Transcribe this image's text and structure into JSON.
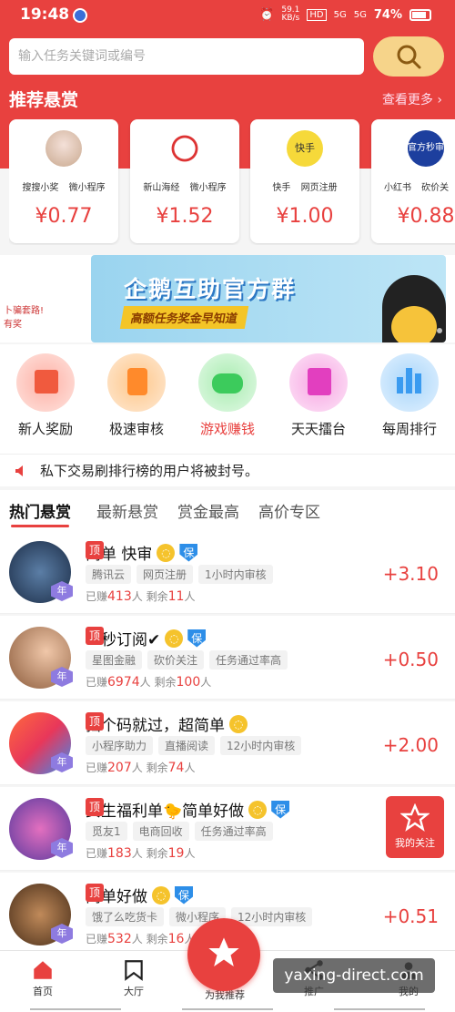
{
  "status": {
    "time": "19:48",
    "speed": "59.1",
    "speed_unit": "KB/s",
    "hd": "HD",
    "net1": "5G",
    "net2": "5G",
    "battery": "74%"
  },
  "search": {
    "placeholder": "输入任务关键词或编号"
  },
  "recommend": {
    "title": "推荐悬赏",
    "more": "查看更多 ›",
    "cards": [
      {
        "tags": "搜搜小奖 微小程序",
        "price": "¥0.77"
      },
      {
        "tags": "新山海经 微小程序",
        "price": "¥1.52"
      },
      {
        "tags": "快手 网页注册",
        "price": "¥1.00",
        "logo_text": "快手"
      },
      {
        "tags": "小红书 砍价关",
        "price": "¥0.88",
        "logo_text": "官方秒审"
      }
    ]
  },
  "banner": {
    "left_text1": "卜骗套路!",
    "left_text2": "有奖",
    "title": "企鹅互助官方群",
    "subtitle": "高额任务奖金早知道"
  },
  "quick": [
    {
      "label": "新人奖励",
      "color": "#333"
    },
    {
      "label": "极速审核",
      "color": "#333"
    },
    {
      "label": "游戏赚钱",
      "color": "#e8413f"
    },
    {
      "label": "天天擂台",
      "color": "#333"
    },
    {
      "label": "每周排行",
      "color": "#333"
    }
  ],
  "notice": "私下交易刷排行榜的用户将被封号。",
  "tabs": [
    "热门悬赏",
    "最新悬赏",
    "赏金最高",
    "高价专区"
  ],
  "badges": {
    "top": "顶",
    "bao": "保",
    "year": "年"
  },
  "items": [
    {
      "title": "简单 快审",
      "tags": [
        "腾讯云",
        "网页注册",
        "1小时内审核"
      ],
      "earned_label": "已赚",
      "earned": "413",
      "unit": "人",
      "left_label": "剩余",
      "left": "11",
      "reward": "+3.10"
    },
    {
      "title": "一秒订阅✔",
      "tags": [
        "星图金融",
        "砍价关注",
        "任务通过率高"
      ],
      "earned_label": "已赚",
      "earned": "6974",
      "unit": "人",
      "left_label": "剩余",
      "left": "100",
      "reward": "+0.50"
    },
    {
      "title": "扫个码就过，超简单",
      "tags": [
        "小程序助力",
        "直播阅读",
        "12小时内审核"
      ],
      "earned_label": "已赚",
      "earned": "207",
      "unit": "人",
      "left_label": "剩余",
      "left": "74",
      "reward": "+2.00"
    },
    {
      "title": "女生福利单🐤简单好做",
      "tags": [
        "觅友1",
        "电商回收",
        "任务通过率高"
      ],
      "earned_label": "已赚",
      "earned": "183",
      "unit": "人",
      "left_label": "剩余",
      "left": "19",
      "reward": ""
    },
    {
      "title": "简单好做",
      "tags": [
        "饿了么吃货卡",
        "微小程序",
        "12小时内审核"
      ],
      "earned_label": "已赚",
      "earned": "532",
      "unit": "人",
      "left_label": "剩余",
      "left": "16",
      "reward": "+0.51"
    }
  ],
  "favorite": "我的关注",
  "nav": {
    "home": "首页",
    "hall": "大厅",
    "center": "为我推荐",
    "promote": "推广",
    "mine": "我的"
  },
  "watermark": "yaxing-direct.com"
}
